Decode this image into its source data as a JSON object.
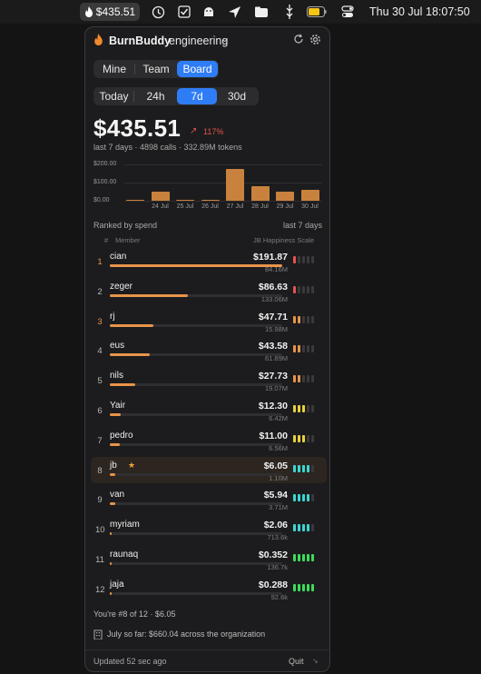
{
  "menubar": {
    "app_amount": "$435.51",
    "date": "Thu 30 Jul",
    "time": "18:07:50",
    "icons": [
      "flame-icon",
      "activity-monitor-icon",
      "checkbox-icon",
      "android-icon",
      "location-icon",
      "folder-cloud-icon",
      "usb-icon",
      "battery-icon",
      "control-center-icon"
    ]
  },
  "header": {
    "app_name": "BurnBuddy",
    "team": "engineering"
  },
  "scope_tabs": [
    {
      "label": "Mine",
      "selected": false
    },
    {
      "label": "Team",
      "selected": false
    },
    {
      "label": "Board",
      "selected": true
    }
  ],
  "range_tabs": [
    {
      "label": "Today",
      "selected": false
    },
    {
      "label": "24h",
      "selected": false
    },
    {
      "label": "7d",
      "selected": true
    },
    {
      "label": "30d",
      "selected": false
    }
  ],
  "summary": {
    "total": "$435.51",
    "trend": "117%",
    "meta": "last 7 days · 4898 calls · 332.89M tokens"
  },
  "chart_data": {
    "type": "bar",
    "categories": [
      "24 Jul",
      "25 Jul",
      "26 Jul",
      "27 Jul",
      "28 Jul",
      "29 Jul",
      "30 Jul"
    ],
    "values": [
      6,
      52,
      2,
      4,
      175,
      78,
      50,
      62
    ],
    "y_tick_labels": [
      "$200.00",
      "$100.00",
      "$0.00"
    ],
    "ylim": [
      0,
      200
    ],
    "grid": true,
    "color": "#c9823d"
  },
  "leaderboard": {
    "title": "Ranked by spend",
    "period": "last 7 days",
    "col_rank": "#",
    "col_member": "Member",
    "col_scale": "JB Happiness Scale",
    "rows": [
      {
        "rank": "1",
        "name": "cian",
        "cost": "$191.87",
        "tokens": "84.16M",
        "share": 1.0,
        "gold": true,
        "me": false,
        "happiness": [
          "#e5534b",
          "#3a3a3c",
          "#3a3a3c",
          "#3a3a3c",
          "#3a3a3c"
        ]
      },
      {
        "rank": "2",
        "name": "zeger",
        "cost": "$86.63",
        "tokens": "133.06M",
        "share": 0.45,
        "gold": false,
        "me": false,
        "happiness": [
          "#e5534b",
          "#3a3a3c",
          "#3a3a3c",
          "#3a3a3c",
          "#3a3a3c"
        ]
      },
      {
        "rank": "3",
        "name": "rj",
        "cost": "$47.71",
        "tokens": "15.98M",
        "share": 0.25,
        "gold": true,
        "me": false,
        "happiness": [
          "#e8944a",
          "#e8944a",
          "#3a3a3c",
          "#3a3a3c",
          "#3a3a3c"
        ]
      },
      {
        "rank": "4",
        "name": "eus",
        "cost": "$43.58",
        "tokens": "61.89M",
        "share": 0.23,
        "gold": false,
        "me": false,
        "happiness": [
          "#e8944a",
          "#e8944a",
          "#3a3a3c",
          "#3a3a3c",
          "#3a3a3c"
        ]
      },
      {
        "rank": "5",
        "name": "nils",
        "cost": "$27.73",
        "tokens": "19.07M",
        "share": 0.145,
        "gold": false,
        "me": false,
        "happiness": [
          "#e8944a",
          "#e8944a",
          "#3a3a3c",
          "#3a3a3c",
          "#3a3a3c"
        ]
      },
      {
        "rank": "6",
        "name": "Yair",
        "cost": "$12.30",
        "tokens": "6.42M",
        "share": 0.065,
        "gold": false,
        "me": false,
        "happiness": [
          "#e8d23a",
          "#e8d23a",
          "#e8d23a",
          "#3a3a3c",
          "#3a3a3c"
        ]
      },
      {
        "rank": "7",
        "name": "pedro",
        "cost": "$11.00",
        "tokens": "6.56M",
        "share": 0.058,
        "gold": false,
        "me": false,
        "happiness": [
          "#e8d23a",
          "#e8d23a",
          "#e8d23a",
          "#3a3a3c",
          "#3a3a3c"
        ]
      },
      {
        "rank": "8",
        "name": "jb",
        "cost": "$6.05",
        "tokens": "1.10M",
        "share": 0.032,
        "gold": false,
        "me": true,
        "happiness": [
          "#3ad7d0",
          "#3ad7d0",
          "#3ad7d0",
          "#3ad7d0",
          "#3a3a3c"
        ]
      },
      {
        "rank": "9",
        "name": "van",
        "cost": "$5.94",
        "tokens": "3.71M",
        "share": 0.031,
        "gold": false,
        "me": false,
        "happiness": [
          "#3ad7d0",
          "#3ad7d0",
          "#3ad7d0",
          "#3ad7d0",
          "#3a3a3c"
        ]
      },
      {
        "rank": "10",
        "name": "myriam",
        "cost": "$2.06",
        "tokens": "713.6k",
        "share": 0.011,
        "gold": false,
        "me": false,
        "happiness": [
          "#3ad7d0",
          "#3ad7d0",
          "#3ad7d0",
          "#3ad7d0",
          "#3a3a3c"
        ]
      },
      {
        "rank": "11",
        "name": "raunaq",
        "cost": "$0.352",
        "tokens": "136.7k",
        "share": 0.002,
        "gold": false,
        "me": false,
        "happiness": [
          "#3ddc5a",
          "#3ddc5a",
          "#3ddc5a",
          "#3ddc5a",
          "#3ddc5a"
        ]
      },
      {
        "rank": "12",
        "name": "jaja",
        "cost": "$0.288",
        "tokens": "92.6k",
        "share": 0.0015,
        "gold": false,
        "me": false,
        "happiness": [
          "#3ddc5a",
          "#3ddc5a",
          "#3ddc5a",
          "#3ddc5a",
          "#3ddc5a"
        ]
      }
    ]
  },
  "footer": {
    "position": "You're #8 of 12 · $6.05",
    "org_total": "July so far: $660.04 across the organization",
    "updated": "Updated 52 sec ago",
    "quit_label": "Quit"
  }
}
